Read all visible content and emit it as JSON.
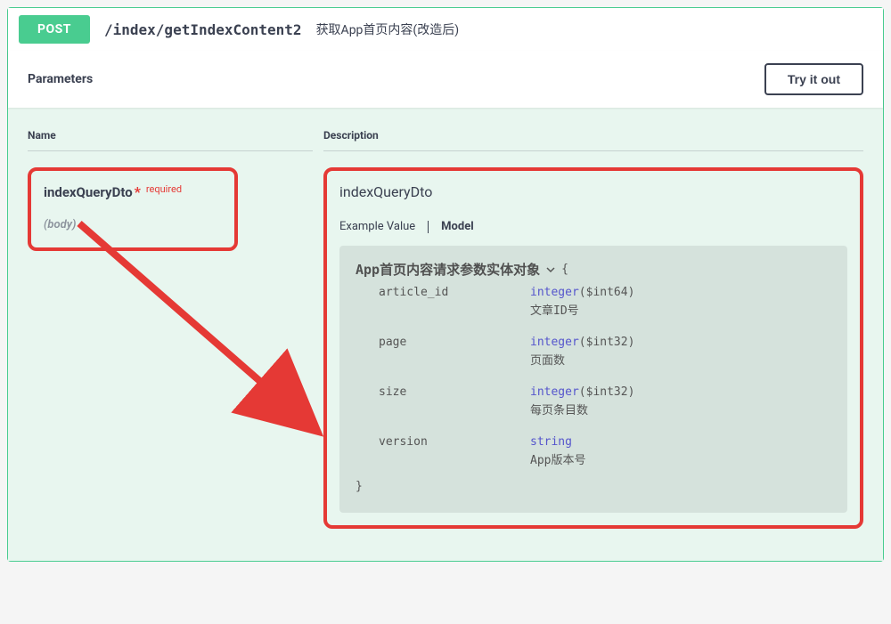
{
  "header": {
    "method": "POST",
    "path": "/index/getIndexContent2",
    "summary": "获取App首页内容(改造后)"
  },
  "params_section": {
    "title": "Parameters",
    "try_btn": "Try it out",
    "name_col": "Name",
    "desc_col": "Description",
    "param": {
      "name": "indexQueryDto",
      "star": "*",
      "required": "required",
      "location": "(body)"
    },
    "desc": {
      "title": "indexQueryDto",
      "tab_example": "Example Value",
      "tab_model": "Model",
      "model": {
        "title": "App首页内容请求参数实体对象",
        "open_brace": "{",
        "close_brace": "}",
        "props": [
          {
            "name": "article_id",
            "type": "integer",
            "format": "($int64)",
            "desc": "文章ID号"
          },
          {
            "name": "page",
            "type": "integer",
            "format": "($int32)",
            "desc": "页面数"
          },
          {
            "name": "size",
            "type": "integer",
            "format": "($int32)",
            "desc": "每页条目数"
          },
          {
            "name": "version",
            "type": "string",
            "format": "",
            "desc": "App版本号"
          }
        ]
      }
    }
  }
}
